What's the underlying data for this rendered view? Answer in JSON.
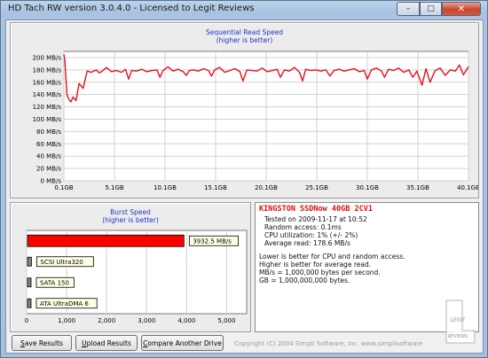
{
  "window": {
    "title": "HD Tach RW version 3.0.4.0 - Licensed to Legit Reviews",
    "min_glyph": "–",
    "max_glyph": "□",
    "close_glyph": "✕"
  },
  "sequential": {
    "title": "Sequential Read Speed",
    "subtitle": "(higher is better)"
  },
  "burst": {
    "title": "Burst Speed",
    "subtitle": "(higher is better)"
  },
  "info": {
    "drive": "KINGSTON SSDNow 40GB 2CV1",
    "tested_on": "Tested on 2009-11-17 at 10:52",
    "random_access": "Random access: 0.1ms",
    "cpu_utilization": "CPU utilization: 1% (+/- 2%)",
    "average_read": "Average read: 178.6 MB/s",
    "notes": [
      "Lower is better for CPU and random access.",
      "Higher is better for average read.",
      "MB/s = 1,000,000 bytes per second.",
      "GB = 1,000,000,000 bytes."
    ]
  },
  "buttons": {
    "save_hotkey": "S",
    "save_rest": "ave Results",
    "upload_hotkey": "U",
    "upload_rest": "pload Results",
    "compare_hotkey": "C",
    "compare_rest": "ompare Another Drive"
  },
  "copyright": "Copyright (C) 2004 Simpli Software, Inc. www.simplisoftware",
  "watermark": {
    "line1": "LEGIT",
    "line2": "REVIEWS"
  },
  "colors": {
    "read_line": "#e8101c",
    "burst_bar": "#ff0000",
    "reference_bar": "#808080",
    "title_blue": "#1f35c8",
    "drive_red": "#d81010"
  },
  "chart_data": [
    {
      "type": "line",
      "title": "Sequential Read Speed",
      "subtitle": "(higher is better)",
      "y_unit": "MB/s",
      "x_unit": "GB",
      "ylim": [
        0,
        210
      ],
      "xlim": [
        0.1,
        40.1
      ],
      "y_ticks": [
        "0 MB/s",
        "20 MB/s",
        "40 MB/s",
        "60 MB/s",
        "80 MB/s",
        "100 MB/s",
        "120 MB/s",
        "140 MB/s",
        "160 MB/s",
        "180 MB/s",
        "200 MB/s"
      ],
      "y_tick_values": [
        0,
        20,
        40,
        60,
        80,
        100,
        120,
        140,
        160,
        180,
        200
      ],
      "x_ticks": [
        "0.1GB",
        "5.1GB",
        "10.1GB",
        "15.1GB",
        "20.1GB",
        "25.1GB",
        "30.1GB",
        "35.1GB",
        "40.1GB"
      ],
      "x_tick_values": [
        0.1,
        5.1,
        10.1,
        15.1,
        20.1,
        25.1,
        30.1,
        35.1,
        40.1
      ],
      "grid": true,
      "series": [
        {
          "x": [
            0.1,
            0.2,
            0.4,
            0.6,
            0.8,
            1.0,
            1.3,
            1.6,
            2.0,
            2.4,
            2.8,
            3.3,
            3.6,
            3.9,
            4.3,
            4.8,
            5.3,
            5.8,
            6.2,
            6.5,
            6.8,
            7.3,
            7.8,
            8.3,
            8.8,
            9.3,
            9.6,
            9.9,
            10.4,
            10.9,
            11.4,
            11.9,
            12.2,
            12.5,
            12.9,
            13.4,
            13.9,
            14.4,
            14.7,
            15.0,
            15.5,
            16.0,
            16.5,
            17.0,
            17.5,
            17.8,
            18.2,
            18.7,
            19.2,
            19.7,
            20.2,
            20.7,
            21.2,
            21.5,
            21.9,
            22.4,
            22.9,
            23.4,
            23.7,
            24.0,
            24.5,
            25.0,
            25.5,
            26.0,
            26.4,
            26.8,
            27.3,
            27.8,
            28.3,
            28.8,
            29.3,
            29.8,
            30.1,
            30.5,
            31.0,
            31.5,
            31.8,
            32.2,
            32.7,
            33.2,
            33.7,
            34.2,
            34.6,
            35.0,
            35.5,
            35.9,
            36.3,
            36.8,
            37.3,
            37.8,
            38.3,
            38.8,
            39.2,
            39.6,
            40.1
          ],
          "y": [
            205,
            195,
            140,
            132,
            128,
            136,
            130,
            158,
            150,
            178,
            176,
            180,
            175,
            178,
            184,
            177,
            179,
            176,
            181,
            165,
            179,
            178,
            181,
            177,
            179,
            180,
            168,
            179,
            185,
            178,
            181,
            177,
            171,
            179,
            180,
            178,
            182,
            179,
            170,
            180,
            184,
            176,
            179,
            182,
            177,
            162,
            180,
            179,
            178,
            183,
            177,
            179,
            181,
            168,
            180,
            178,
            184,
            176,
            162,
            181,
            179,
            180,
            178,
            180,
            170,
            179,
            181,
            178,
            180,
            182,
            177,
            179,
            165,
            180,
            183,
            178,
            168,
            181,
            179,
            183,
            176,
            180,
            168,
            178,
            155,
            182,
            160,
            179,
            183,
            171,
            180,
            178,
            188,
            172,
            185
          ]
        }
      ]
    },
    {
      "type": "bar",
      "orientation": "horizontal",
      "title": "Burst Speed",
      "subtitle": "(higher is better)",
      "xlim": [
        0,
        5500
      ],
      "x_ticks": [
        "0",
        "1,000",
        "2,000",
        "3,000",
        "4,000",
        "5,000"
      ],
      "x_tick_values": [
        0,
        1000,
        2000,
        3000,
        4000,
        5000
      ],
      "grid": true,
      "bars": [
        {
          "label": "3932.5 MB/s",
          "value": 3932.5,
          "highlight": true
        },
        {
          "label": "SCSI Ultra320",
          "value": 120,
          "highlight": false
        },
        {
          "label": "SATA 150",
          "value": 60,
          "highlight": false
        },
        {
          "label": "ATA UltraDMA 6",
          "value": 40,
          "highlight": false
        }
      ]
    }
  ]
}
